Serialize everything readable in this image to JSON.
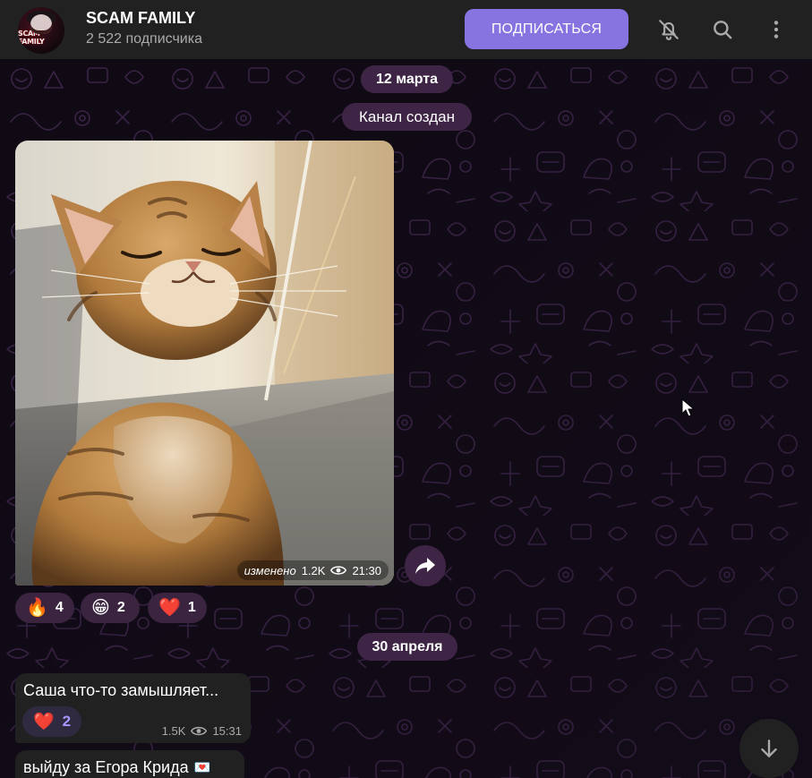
{
  "header": {
    "channel_name": "SCAM FAMILY",
    "subscribers": "2 522 подписчика",
    "avatar_text": "SCAM FAMILY",
    "subscribe_label": "ПОДПИСАТЬСЯ",
    "icons": [
      "bell-muted-icon",
      "search-icon",
      "more-vertical-icon"
    ]
  },
  "dates": {
    "first": "12 марта",
    "service": "Канал создан",
    "second": "30 апреля"
  },
  "photo_post": {
    "edited_label": "изменено",
    "views": "1.2K",
    "time": "21:30",
    "reactions": [
      {
        "emoji": "🔥",
        "count": "4"
      },
      {
        "emoji": "😁",
        "count": "2"
      },
      {
        "emoji": "❤️",
        "count": "1"
      }
    ]
  },
  "messages": [
    {
      "text": "Саша что-то замышляет...",
      "reaction_emoji": "❤️",
      "reaction_count": "2",
      "views": "1.5K",
      "time": "15:31"
    },
    {
      "text": "выйду за Егора Крида",
      "emoji": "💌"
    }
  ],
  "colors": {
    "accent": "#8774e1",
    "header_bg": "#212121",
    "pill_bg": "#3e2545",
    "chat_bg": "#0f0a14",
    "reaction_text": "#a896ff"
  }
}
